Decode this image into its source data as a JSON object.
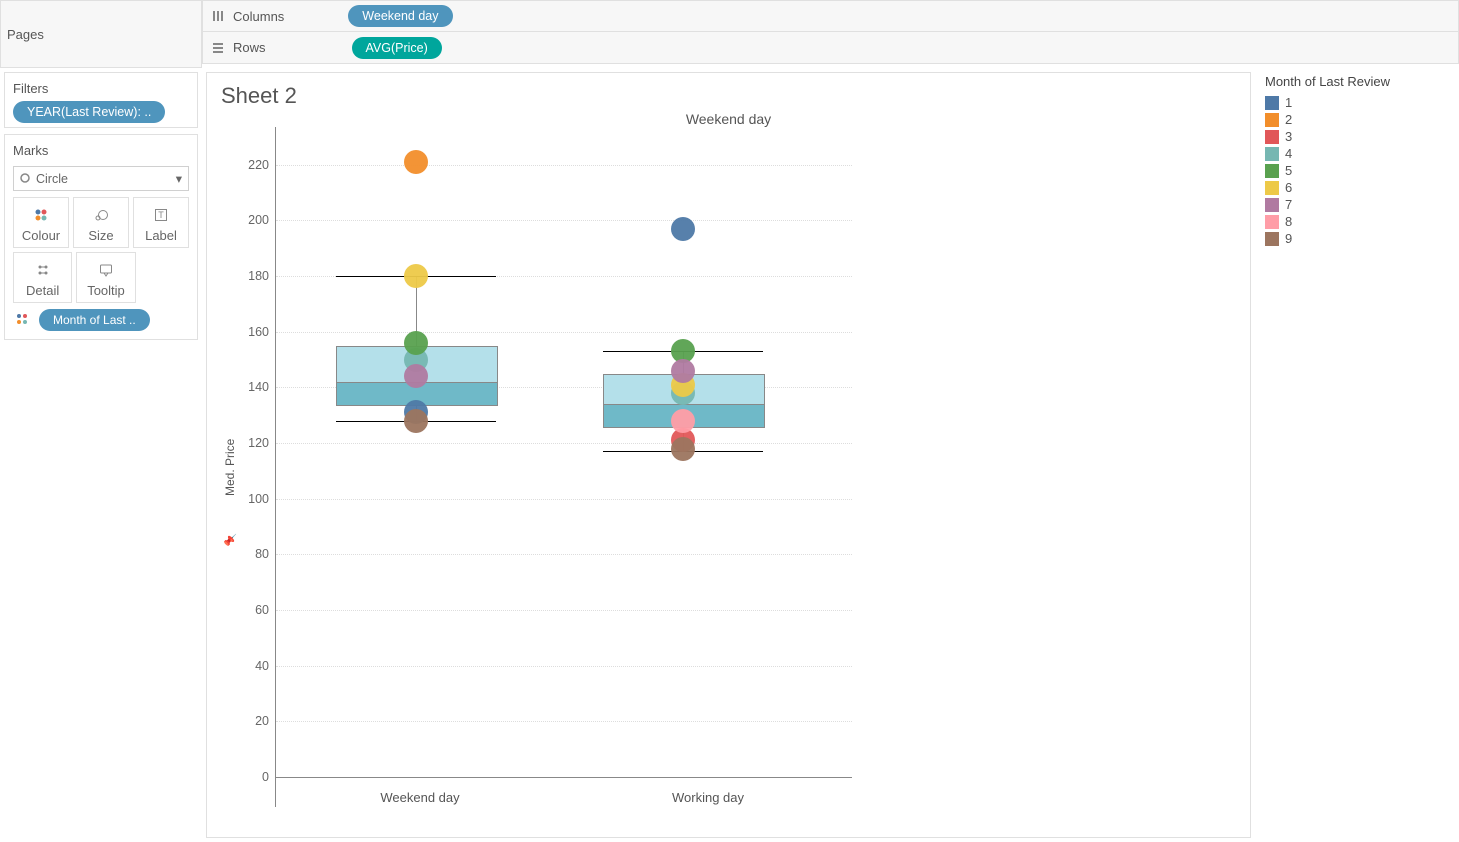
{
  "shelves": {
    "pages_label": "Pages",
    "columns_label": "Columns",
    "rows_label": "Rows",
    "columns_pill": "Weekend day",
    "rows_pill": "AVG(Price)"
  },
  "filters": {
    "title": "Filters",
    "pill": "YEAR(Last Review): .."
  },
  "marks": {
    "title": "Marks",
    "type": "Circle",
    "buttons": [
      "Colour",
      "Size",
      "Label",
      "Detail",
      "Tooltip"
    ],
    "legend_pill": "Month of Last .."
  },
  "sheet": {
    "title": "Sheet 2"
  },
  "legend": {
    "title": "Month of Last Review",
    "items": [
      {
        "label": "1",
        "color": "#4e79a7"
      },
      {
        "label": "2",
        "color": "#f28e2b"
      },
      {
        "label": "3",
        "color": "#e15759"
      },
      {
        "label": "4",
        "color": "#76b7b2"
      },
      {
        "label": "5",
        "color": "#59a14f"
      },
      {
        "label": "6",
        "color": "#edc948"
      },
      {
        "label": "7",
        "color": "#b07aa1"
      },
      {
        "label": "8",
        "color": "#ff9da7"
      },
      {
        "label": "9",
        "color": "#9c755f"
      }
    ]
  },
  "chart_data": {
    "type": "scatter",
    "title": "Weekend day",
    "xlabel": "Weekend day",
    "ylabel": "Med. Price",
    "categories": [
      "Weekend day",
      "Working day"
    ],
    "ylim": [
      0,
      230
    ],
    "yticks": [
      0,
      20,
      40,
      60,
      80,
      100,
      120,
      140,
      160,
      180,
      200,
      220
    ],
    "series": [
      {
        "name": "1",
        "color": "#4e79a7",
        "values": [
          131,
          197
        ]
      },
      {
        "name": "2",
        "color": "#f28e2b",
        "values": [
          221,
          null
        ]
      },
      {
        "name": "3",
        "color": "#e15759",
        "values": [
          null,
          121
        ]
      },
      {
        "name": "4",
        "color": "#76b7b2",
        "values": [
          150,
          138
        ]
      },
      {
        "name": "5",
        "color": "#59a14f",
        "values": [
          156,
          153
        ]
      },
      {
        "name": "6",
        "color": "#edc948",
        "values": [
          180,
          141
        ]
      },
      {
        "name": "7",
        "color": "#b07aa1",
        "values": [
          144,
          146
        ]
      },
      {
        "name": "8",
        "color": "#ff9da7",
        "values": [
          null,
          128
        ]
      },
      {
        "name": "9",
        "color": "#9c755f",
        "values": [
          128,
          118
        ]
      }
    ],
    "box_plots": [
      {
        "category": "Weekend day",
        "min": 128,
        "q1": 134,
        "median": 142,
        "q3": 155,
        "max": 180
      },
      {
        "category": "Working day",
        "min": 117,
        "q1": 126,
        "median": 134,
        "q3": 145,
        "max": 153
      }
    ]
  }
}
